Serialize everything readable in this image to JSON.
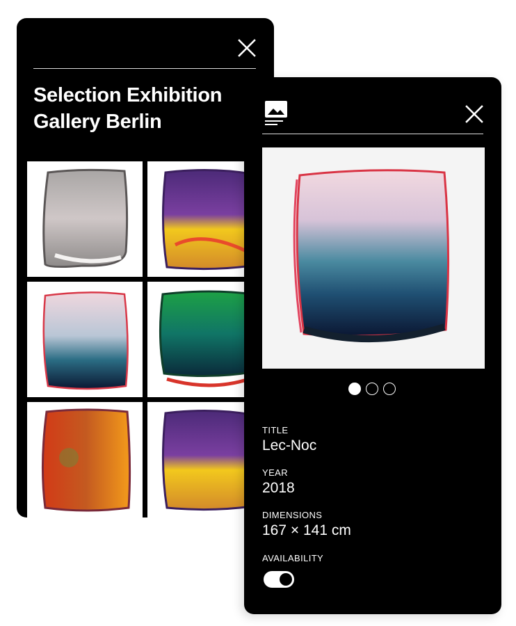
{
  "gallery": {
    "title": "Selection Exhibition Gallery Berlin",
    "close_icon": "close-icon",
    "thumbnails": [
      {
        "artwork": "grey-white",
        "palette": [
          "#8f8f8f",
          "#cfc8c4",
          "#6d6a6a"
        ]
      },
      {
        "artwork": "purple-yellow",
        "palette": [
          "#5b2a82",
          "#f0c21b",
          "#d8842a"
        ]
      },
      {
        "artwork": "pink-blue",
        "palette": [
          "#e7c7d1",
          "#2f6f86",
          "#0d1b3b"
        ]
      },
      {
        "artwork": "green-blue",
        "palette": [
          "#1c8d3c",
          "#0f5c66",
          "#0a2c3b"
        ]
      },
      {
        "artwork": "red-orange",
        "palette": [
          "#d63418",
          "#f39a1b",
          "#6b2a48"
        ]
      },
      {
        "artwork": "purple-yellow-2",
        "palette": [
          "#5b2a82",
          "#f0c21b",
          "#d8842a"
        ]
      }
    ]
  },
  "detail": {
    "image_icon": "image-icon",
    "close_icon": "close-icon",
    "carousel": {
      "count": 3,
      "active": 0
    },
    "title_label": "TITLE",
    "title": "Lec-Noc",
    "year_label": "YEAR",
    "year": "2018",
    "dimensions_label": "DIMENSIONS",
    "dimensions": "167 × 141 cm",
    "availability_label": "AVAILABILITY",
    "availability": true
  }
}
